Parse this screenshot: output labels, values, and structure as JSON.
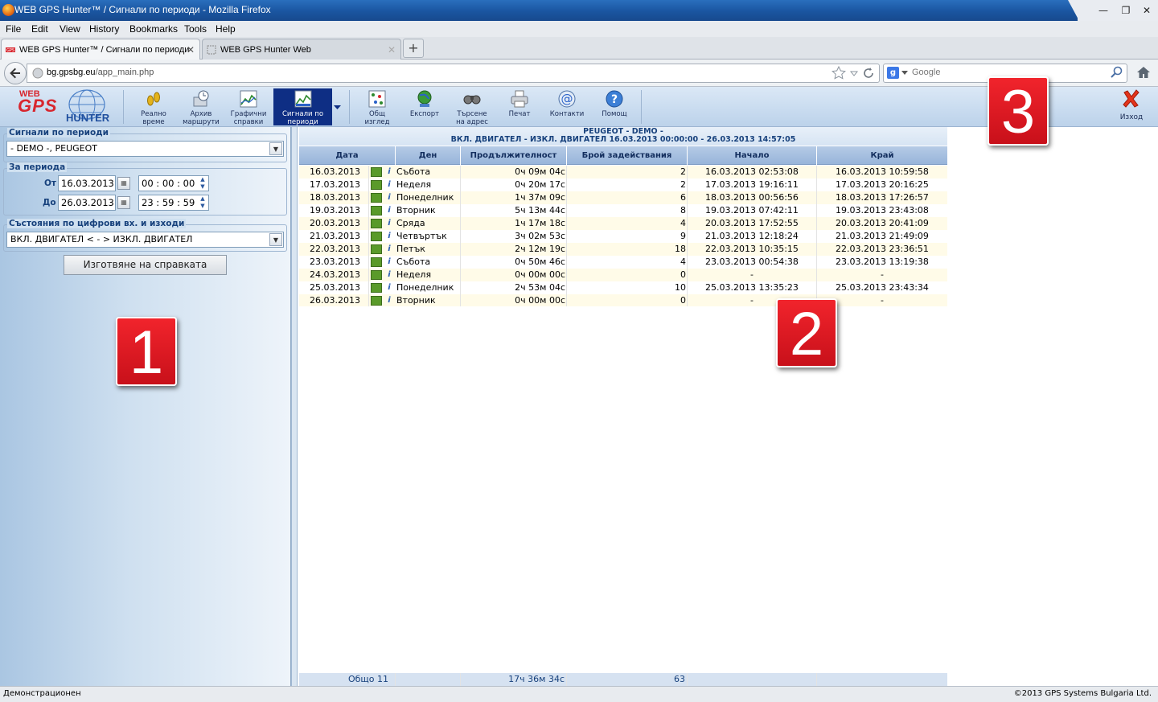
{
  "window": {
    "title": "WEB GPS Hunter™ / Сигнали по периоди - Mozilla Firefox",
    "controls": [
      "—",
      "❐",
      "✕"
    ]
  },
  "menu": [
    "File",
    "Edit",
    "View",
    "History",
    "Bookmarks",
    "Tools",
    "Help"
  ],
  "tabs": [
    {
      "label": "WEB GPS Hunter™ / Сигнали по периоди",
      "active": true
    },
    {
      "label": "WEB GPS Hunter Web",
      "active": false
    }
  ],
  "newtab_label": "+",
  "nav": {
    "url_domain": "bg.gpsbg.eu",
    "url_path": "/app_main.php",
    "search_engine": "g",
    "search_placeholder": "Google"
  },
  "app": {
    "logo": {
      "line1": "WEB",
      "line2": "GPS",
      "line3": "HUNTER"
    },
    "toolbar": [
      {
        "line1": "Реално",
        "line2": "време",
        "icon": "footprints-icon"
      },
      {
        "line1": "Архив",
        "line2": "маршрути",
        "icon": "archive-clock-icon"
      },
      {
        "line1": "Графични",
        "line2": "справки",
        "icon": "chart-icon"
      },
      {
        "line1": "Сигнали по",
        "line2": "периоди",
        "icon": "signals-chart-icon",
        "active": true
      },
      {
        "line1": "Общ",
        "line2": "изглед",
        "icon": "overview-grid-icon"
      },
      {
        "line1": "Експорт",
        "line2": "",
        "icon": "export-globe-icon"
      },
      {
        "line1": "Търсене",
        "line2": "на адрес",
        "icon": "binoculars-icon"
      },
      {
        "line1": "Печат",
        "line2": "",
        "icon": "printer-icon"
      },
      {
        "line1": "Контакти",
        "line2": "",
        "icon": "at-sign-icon"
      },
      {
        "line1": "Помощ",
        "line2": "",
        "icon": "help-icon"
      }
    ],
    "exit_label": "Изход"
  },
  "left": {
    "vehicle_legend": "Сигнали по периоди",
    "vehicle_value": "- DEMO -, PEUGEOT",
    "period_legend": "За периода",
    "from_label": "От",
    "from_date": "16.03.2013",
    "from_time": "00 : 00 : 00",
    "to_label": "До",
    "to_date": "26.03.2013",
    "to_time": "23 : 59 : 59",
    "states_legend": "Състояния по цифрови вх. и изходи",
    "states_value": "ВКЛ. ДВИГАТЕЛ < - > ИЗКЛ. ДВИГАТЕЛ",
    "generate_label": "Изготвяне на справката"
  },
  "report": {
    "title1": "PEUGEOT - DEMO -",
    "title2": "ВКЛ. ДВИГАТЕЛ - ИЗКЛ. ДВИГАТЕЛ 16.03.2013 00:00:00 - 26.03.2013 14:57:05",
    "columns": [
      "Дата",
      "Ден",
      "Продължителност",
      "Брой задействания",
      "Начало",
      "Край"
    ],
    "rows": [
      {
        "date": "16.03.2013",
        "day": "Събота",
        "duration": "0ч 09м 04с",
        "count": "2",
        "start": "16.03.2013 02:53:08",
        "end": "16.03.2013 10:59:58"
      },
      {
        "date": "17.03.2013",
        "day": "Неделя",
        "duration": "0ч 20м 17с",
        "count": "2",
        "start": "17.03.2013 19:16:11",
        "end": "17.03.2013 20:16:25"
      },
      {
        "date": "18.03.2013",
        "day": "Понеделник",
        "duration": "1ч 37м 09с",
        "count": "6",
        "start": "18.03.2013 00:56:56",
        "end": "18.03.2013 17:26:57"
      },
      {
        "date": "19.03.2013",
        "day": "Вторник",
        "duration": "5ч 13м 44с",
        "count": "8",
        "start": "19.03.2013 07:42:11",
        "end": "19.03.2013 23:43:08"
      },
      {
        "date": "20.03.2013",
        "day": "Сряда",
        "duration": "1ч 17м 18с",
        "count": "4",
        "start": "20.03.2013 17:52:55",
        "end": "20.03.2013 20:41:09"
      },
      {
        "date": "21.03.2013",
        "day": "Четвъртък",
        "duration": "3ч 02м 53с",
        "count": "9",
        "start": "21.03.2013 12:18:24",
        "end": "21.03.2013 21:49:09"
      },
      {
        "date": "22.03.2013",
        "day": "Петък",
        "duration": "2ч 12м 19с",
        "count": "18",
        "start": "22.03.2013 10:35:15",
        "end": "22.03.2013 23:36:51"
      },
      {
        "date": "23.03.2013",
        "day": "Събота",
        "duration": "0ч 50м 46с",
        "count": "4",
        "start": "23.03.2013 00:54:38",
        "end": "23.03.2013 13:19:38"
      },
      {
        "date": "24.03.2013",
        "day": "Неделя",
        "duration": "0ч 00м 00с",
        "count": "0",
        "start": "-",
        "end": "-"
      },
      {
        "date": "25.03.2013",
        "day": "Понеделник",
        "duration": "2ч 53м 04с",
        "count": "10",
        "start": "25.03.2013 13:35:23",
        "end": "25.03.2013 23:43:34"
      },
      {
        "date": "26.03.2013",
        "day": "Вторник",
        "duration": "0ч 00м 00с",
        "count": "0",
        "start": "-",
        "end": "-"
      }
    ],
    "footer": {
      "total_label": "Общо 11",
      "total_duration": "17ч 36м 34с",
      "total_count": "63"
    }
  },
  "callouts": [
    "1",
    "2",
    "3"
  ],
  "status": {
    "left": "Демонстрационен",
    "right": "©2013 GPS Systems Bulgaria Ltd."
  },
  "colors": {
    "accent": "#0e2e84",
    "callout": "#e01a22",
    "row_alt": "#fffbe8"
  }
}
